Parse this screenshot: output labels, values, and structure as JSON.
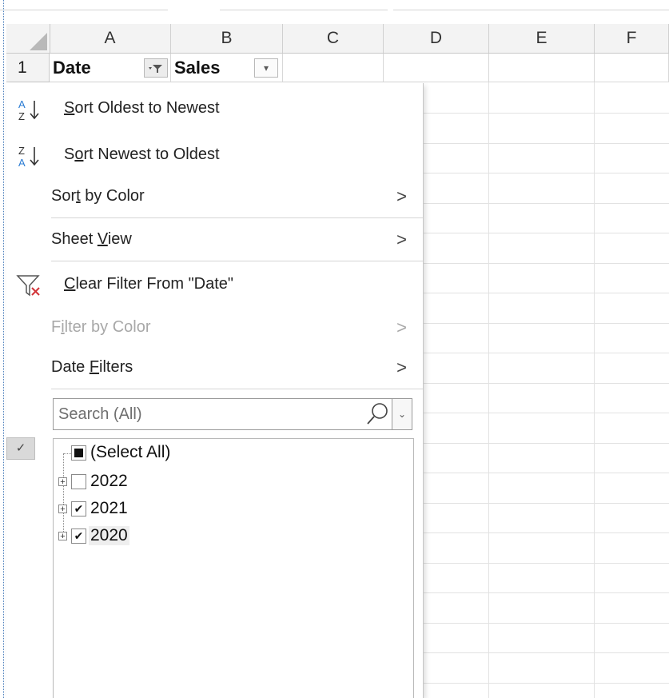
{
  "grid": {
    "columns": [
      "A",
      "B",
      "C",
      "D",
      "E",
      "F"
    ],
    "row_number": "1",
    "cells": {
      "a1": "Date",
      "b1": "Sales"
    }
  },
  "filter_menu": {
    "items": [
      {
        "label_pre": "",
        "label_ul": "S",
        "label_post": "ort Oldest to Newest",
        "icon": "sort-ascending-icon"
      },
      {
        "label_pre": "S",
        "label_ul": "o",
        "label_post": "rt Newest to Oldest",
        "icon": "sort-descending-icon"
      },
      {
        "label_pre": "Sor",
        "label_ul": "t",
        "label_post": " by Color",
        "has_submenu": true
      },
      {
        "label_pre": "Sheet ",
        "label_ul": "V",
        "label_post": "iew",
        "has_submenu": true
      },
      {
        "label_pre": "",
        "label_ul": "C",
        "label_post": "lear Filter From \"Date\"",
        "icon": "clear-filter-icon"
      },
      {
        "label_pre": "F",
        "label_ul": "i",
        "label_post": "lter by Color",
        "has_submenu": true,
        "disabled": true
      },
      {
        "label_pre": "Date ",
        "label_ul": "F",
        "label_post": "ilters",
        "has_submenu": true
      }
    ],
    "submenu_arrow": ">",
    "search": {
      "placeholder": "Search (All)"
    },
    "check_marker": "✓",
    "tree": [
      {
        "label": "(Select All)",
        "state": "partial"
      },
      {
        "label": "2022",
        "state": "unchecked",
        "expander": "+"
      },
      {
        "label": "2021",
        "state": "checked",
        "expander": "+"
      },
      {
        "label": "2020",
        "state": "checked",
        "expander": "+"
      }
    ],
    "check_glyph": "✔"
  },
  "colors": {
    "header_bg": "#f3f3f3",
    "gridline": "#e2e2e2",
    "sort_icon_blue": "#2b7cd3",
    "clear_filter_red": "#d13438"
  }
}
